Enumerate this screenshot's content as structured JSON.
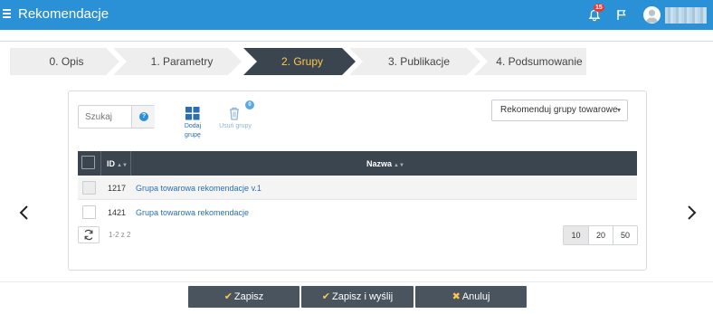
{
  "app": {
    "title": "Rekomendacje"
  },
  "header": {
    "notifications_count": "15"
  },
  "steps": [
    {
      "label": "0. Opis",
      "active": false
    },
    {
      "label": "1. Parametry",
      "active": false
    },
    {
      "label": "2. Grupy",
      "active": true
    },
    {
      "label": "3. Publikacje",
      "active": false
    },
    {
      "label": "4. Podsumowanie",
      "active": false
    }
  ],
  "toolbar": {
    "search_placeholder": "Szukaj",
    "help_label": "?",
    "add_group_label": "Dodaj grupę",
    "delete_group_label": "Usuń grupy",
    "delete_group_count": "0",
    "recommend_select_value": "Rekomenduj grupy towarowe"
  },
  "table": {
    "columns": [
      "ID",
      "Nazwa"
    ],
    "rows": [
      {
        "id": "1217",
        "name": "Grupa towarowa rekomendacje v.1"
      },
      {
        "id": "1421",
        "name": "Grupa towarowa rekomendacje"
      }
    ]
  },
  "pager": {
    "info": "1-2 z 2",
    "sizes": [
      "10",
      "20",
      "50"
    ],
    "selected": "10"
  },
  "footer": {
    "save": "Zapisz",
    "save_send": "Zapisz i wyślij",
    "cancel": "Anuluj"
  },
  "colors": {
    "brand": "#2b91d6",
    "dark": "#3b4550",
    "accent": "#ffc64d",
    "link": "#2b6fae"
  }
}
